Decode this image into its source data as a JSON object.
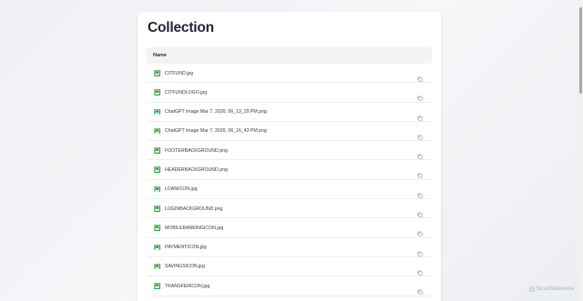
{
  "page": {
    "title": "Collection"
  },
  "table": {
    "header": "Name",
    "rows": [
      {
        "name": "CITFUND.jpg"
      },
      {
        "name": "CITFUNDLOGO.jpg"
      },
      {
        "name": "ChatGPT Image Mar 7, 2026, 06_13_29 PM.png"
      },
      {
        "name": "ChatGPT Image Mar 7, 2026, 06_16_43 PM.png"
      },
      {
        "name": "FOOTERBACKGROUND.png"
      },
      {
        "name": "HEADERBACKGROUND.png"
      },
      {
        "name": "LOANICON.jpg"
      },
      {
        "name": "LOGINBACKGROUND.png"
      },
      {
        "name": "MOBILEBANKINGICON.jpg"
      },
      {
        "name": "PAYMENTICON.jpg"
      },
      {
        "name": "SAVINGSICON.jpg"
      },
      {
        "name": "TRANSFERICON.jpg"
      }
    ]
  },
  "icons": {
    "file": "image-icon",
    "action": "copy-icon"
  },
  "colors": {
    "file_icon": "#2f9e44",
    "copy_icon": "#9aa1ab",
    "title": "#1f2430"
  },
  "watermark": {
    "text": "ScanMalware"
  }
}
